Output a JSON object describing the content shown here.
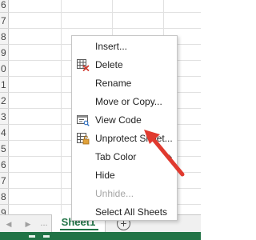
{
  "grid": {
    "row_numbers": [
      "6",
      "7",
      "8",
      "9",
      "0",
      "1",
      "2",
      "3",
      "4",
      "5",
      "6",
      "7",
      "8",
      "9"
    ]
  },
  "tabbar": {
    "prev_arrow": "◀",
    "next_arrow": "▶",
    "more_tabs": "...",
    "active_sheet": "Sheet1",
    "add_sheet_symbol": "+"
  },
  "context_menu": {
    "items": [
      {
        "label": "Insert...",
        "icon": null,
        "enabled": true
      },
      {
        "label": "Delete",
        "icon": "delete-sheet-icon",
        "enabled": true
      },
      {
        "label": "Rename",
        "icon": null,
        "enabled": true
      },
      {
        "label": "Move or Copy...",
        "icon": null,
        "enabled": true
      },
      {
        "label": "View Code",
        "icon": "view-code-icon",
        "enabled": true
      },
      {
        "label": "Unprotect Sheet...",
        "icon": "unprotect-sheet-icon",
        "enabled": true
      },
      {
        "label": "Tab Color",
        "icon": null,
        "enabled": true,
        "submenu": true
      },
      {
        "label": "Hide",
        "icon": null,
        "enabled": true
      },
      {
        "label": "Unhide...",
        "icon": null,
        "enabled": false
      },
      {
        "label": "Select All Sheets",
        "icon": null,
        "enabled": true
      }
    ]
  },
  "colors": {
    "excel_green": "#217346",
    "annotation_red": "#e03a2f",
    "menu_border": "#c6c6c6",
    "disabled_text": "#a6a6a6"
  }
}
